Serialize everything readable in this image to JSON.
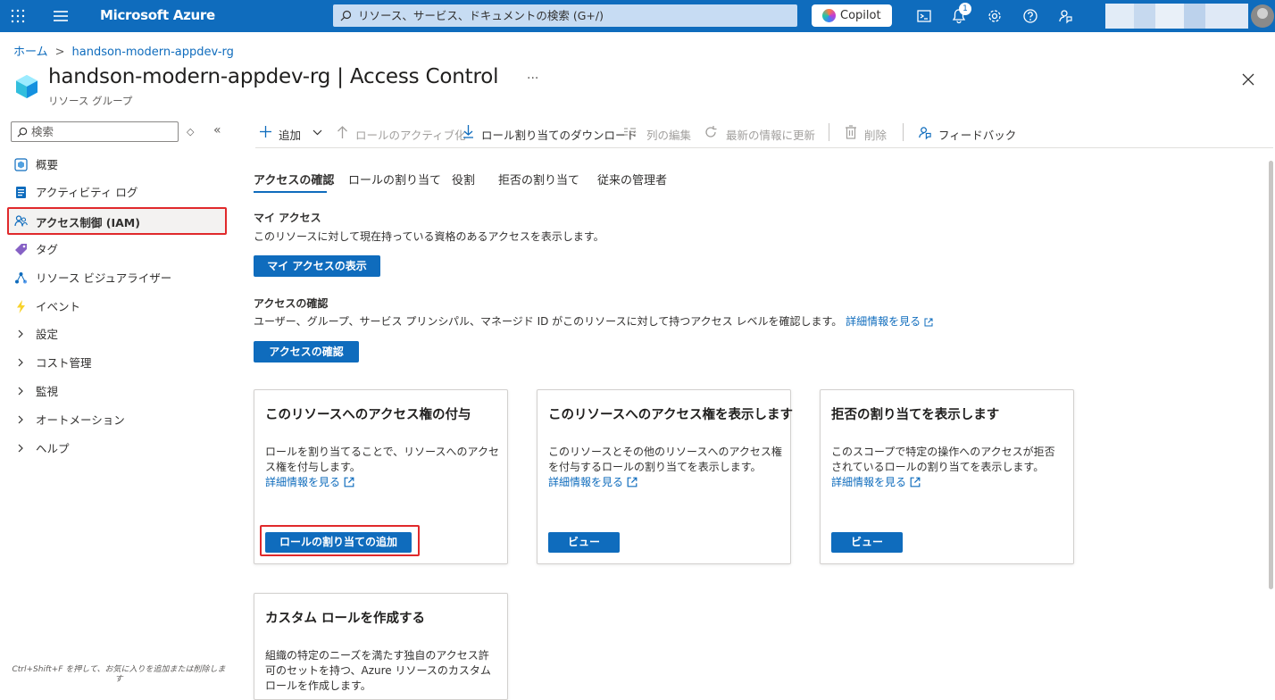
{
  "topbar": {
    "brand": "Microsoft Azure",
    "search_placeholder": "リソース、サービス、ドキュメントの検索 (G+/)",
    "copilot_label": "Copilot",
    "notification_count": "1"
  },
  "breadcrumb": {
    "home": "ホーム",
    "current": "handson-modern-appdev-rg"
  },
  "header": {
    "title": "handson-modern-appdev-rg | Access Control",
    "more": "···",
    "subtitle": "リソース グループ"
  },
  "sidebar": {
    "search_placeholder": "検索",
    "items": [
      {
        "label": "概要",
        "icon": "overview-icon"
      },
      {
        "label": "アクティビティ ログ",
        "icon": "activity-log-icon"
      },
      {
        "label": "アクセス制御 (IAM)",
        "icon": "iam-people-icon",
        "selected": true
      },
      {
        "label": "タグ",
        "icon": "tag-icon"
      },
      {
        "label": "リソース ビジュアライザー",
        "icon": "visualizer-icon"
      },
      {
        "label": "イベント",
        "icon": "lightning-icon"
      },
      {
        "label": "設定",
        "icon": "chevron-right-icon"
      },
      {
        "label": "コスト管理",
        "icon": "chevron-right-icon"
      },
      {
        "label": "監視",
        "icon": "chevron-right-icon"
      },
      {
        "label": "オートメーション",
        "icon": "chevron-right-icon"
      },
      {
        "label": "ヘルプ",
        "icon": "chevron-right-icon"
      }
    ],
    "footer_tip": "Ctrl+Shift+F を押して、お気に入りを追加または削除します"
  },
  "commandbar": {
    "add": "追加",
    "activate_role": "ロールのアクティブ化",
    "download": "ロール割り当てのダウンロード",
    "edit_columns": "列の編集",
    "refresh": "最新の情報に更新",
    "delete": "削除",
    "feedback": "フィードバック"
  },
  "tabs": [
    "アクセスの確認",
    "ロールの割り当て",
    "役割",
    "拒否の割り当て",
    "従来の管理者"
  ],
  "my_access": {
    "heading": "マイ アクセス",
    "description": "このリソースに対して現在持っている資格のあるアクセスを表示します。",
    "button": "マイ アクセスの表示"
  },
  "check_access": {
    "heading": "アクセスの確認",
    "description": "ユーザー、グループ、サービス プリンシパル、マネージド ID がこのリソースに対して持つアクセス レベルを確認します。",
    "link": "詳細情報を見る",
    "button": "アクセスの確認"
  },
  "cards": [
    {
      "title": "このリソースへのアクセス権の付与",
      "body": "ロールを割り当てることで、リソースへのアクセス権を付与します。",
      "link": "詳細情報を見る",
      "button": "ロールの割り当ての追加"
    },
    {
      "title": "このリソースへのアクセス権を表示します",
      "body": "このリソースとその他のリソースへのアクセス権を付与するロールの割り当てを表示します。",
      "link": "詳細情報を見る",
      "button": "ビュー"
    },
    {
      "title": "拒否の割り当てを表示します",
      "body": "このスコープで特定の操作へのアクセスが拒否されているロールの割り当てを表示します。",
      "link": "詳細情報を見る",
      "button": "ビュー"
    },
    {
      "title": "カスタム ロールを作成する",
      "body": "組織の特定のニーズを満たす独自のアクセス許可のセットを持つ、Azure リソースのカスタム ロールを作成します。"
    }
  ]
}
